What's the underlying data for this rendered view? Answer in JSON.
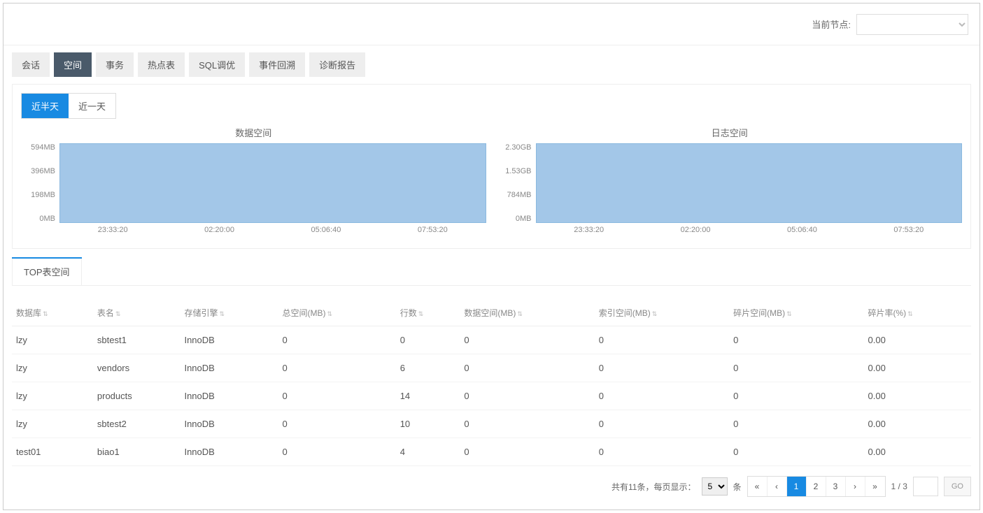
{
  "header": {
    "node_label": "当前节点:",
    "node_value": ""
  },
  "global_tabs": [
    {
      "label": "会话",
      "active": false
    },
    {
      "label": "空间",
      "active": true
    },
    {
      "label": "事务",
      "active": false
    },
    {
      "label": "热点表",
      "active": false
    },
    {
      "label": "SQL调优",
      "active": false
    },
    {
      "label": "事件回溯",
      "active": false
    },
    {
      "label": "诊断报告",
      "active": false
    }
  ],
  "range_tabs": {
    "half_day": "近半天",
    "one_day": "近一天"
  },
  "chart_data": [
    {
      "type": "area",
      "title": "数据空间",
      "y_ticks": [
        "594MB",
        "396MB",
        "198MB",
        "0MB"
      ],
      "x_ticks": [
        "23:33:20",
        "02:20:00",
        "05:06:40",
        "07:53:20"
      ],
      "series": [
        {
          "name": "数据空间",
          "constant_value_mb": 594
        }
      ]
    },
    {
      "type": "area",
      "title": "日志空间",
      "y_ticks": [
        "2.30GB",
        "1.53GB",
        "784MB",
        "0MB"
      ],
      "x_ticks": [
        "23:33:20",
        "02:20:00",
        "05:06:40",
        "07:53:20"
      ],
      "series": [
        {
          "name": "日志空间",
          "constant_value_gb": 2.3
        }
      ]
    }
  ],
  "sub_tab": "TOP表空间",
  "table": {
    "columns": [
      "数据库",
      "表名",
      "存储引擎",
      "总空间(MB)",
      "行数",
      "数据空间(MB)",
      "索引空间(MB)",
      "碎片空间(MB)",
      "碎片率(%)"
    ],
    "rows": [
      {
        "db": "lzy",
        "tbl": "sbtest1",
        "eng": "InnoDB",
        "total": "0",
        "rows": "0",
        "data": "0",
        "idx": "0",
        "frag": "0",
        "rate": "0.00"
      },
      {
        "db": "lzy",
        "tbl": "vendors",
        "eng": "InnoDB",
        "total": "0",
        "rows": "6",
        "data": "0",
        "idx": "0",
        "frag": "0",
        "rate": "0.00"
      },
      {
        "db": "lzy",
        "tbl": "products",
        "eng": "InnoDB",
        "total": "0",
        "rows": "14",
        "data": "0",
        "idx": "0",
        "frag": "0",
        "rate": "0.00"
      },
      {
        "db": "lzy",
        "tbl": "sbtest2",
        "eng": "InnoDB",
        "total": "0",
        "rows": "10",
        "data": "0",
        "idx": "0",
        "frag": "0",
        "rate": "0.00"
      },
      {
        "db": "test01",
        "tbl": "biao1",
        "eng": "InnoDB",
        "total": "0",
        "rows": "4",
        "data": "0",
        "idx": "0",
        "frag": "0",
        "rate": "0.00"
      }
    ]
  },
  "pagination": {
    "summary_prefix": "共有",
    "total": "11",
    "summary_suffix": "条，每页显示：",
    "page_size": "5",
    "unit": "条",
    "first": "«",
    "prev": "‹",
    "pages": [
      "1",
      "2",
      "3"
    ],
    "next": "›",
    "last": "»",
    "indicator": "1 / 3",
    "go": "GO"
  }
}
